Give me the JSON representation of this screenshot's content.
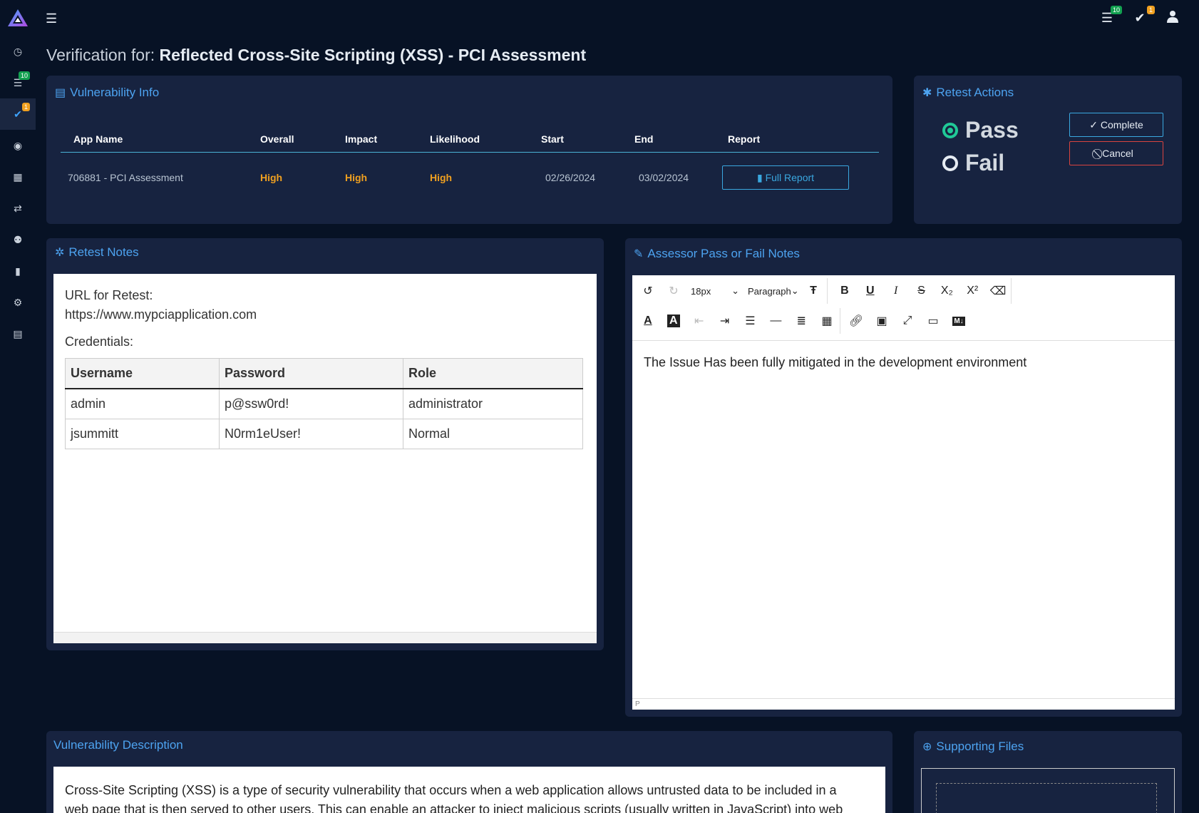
{
  "topbar": {
    "logo": "triangle-logo",
    "badges": {
      "list": "10",
      "check": "1"
    }
  },
  "sidebar": {
    "items": [
      {
        "icon": "dashboard-icon",
        "glyph": "◷"
      },
      {
        "icon": "list-icon",
        "glyph": "☰",
        "badge": "10"
      },
      {
        "icon": "check-icon",
        "glyph": "✔",
        "badge": "1",
        "active": true
      },
      {
        "icon": "eye-icon",
        "glyph": "◉"
      },
      {
        "icon": "calendar-icon",
        "glyph": "▦"
      },
      {
        "icon": "retweet-icon",
        "glyph": "⇄"
      },
      {
        "icon": "users-icon",
        "glyph": "⚉"
      },
      {
        "icon": "chart-icon",
        "glyph": "▮"
      },
      {
        "icon": "gear-icon",
        "glyph": "⚙"
      },
      {
        "icon": "book-icon",
        "glyph": "▤"
      }
    ]
  },
  "page": {
    "title_prefix": "Verification for:",
    "title_name": "Reflected Cross-Site Scripting (XSS) - PCI Assessment"
  },
  "vuln_info": {
    "title": "Vulnerability Info",
    "headers": [
      "App Name",
      "Overall",
      "Impact",
      "Likelihood",
      "Start",
      "End",
      "Report"
    ],
    "row": {
      "app_name": "706881 - PCI Assessment",
      "overall": "High",
      "impact": "High",
      "likelihood": "High",
      "start": "02/26/2024",
      "end": "03/02/2024",
      "report_button": "Full Report"
    }
  },
  "retest_actions": {
    "title": "Retest Actions",
    "pass_label": "Pass",
    "fail_label": "Fail",
    "complete_label": "Complete",
    "cancel_label": "Cancel"
  },
  "retest_notes": {
    "title": "Retest Notes",
    "url_label": "URL for Retest:",
    "url": "https://www.mypciapplication.com",
    "credentials_label": "Credentials:",
    "headers": [
      "Username",
      "Password",
      "Role"
    ],
    "rows": [
      [
        "admin",
        "p@ssw0rd!",
        "administrator"
      ],
      [
        "jsummitt",
        "N0rm1eUser!",
        "Normal"
      ]
    ]
  },
  "assessor_notes": {
    "title": "Assessor Pass or Fail Notes",
    "font_size": "18px",
    "block_format": "Paragraph",
    "content": "The Issue Has been fully mitigated in the development environment",
    "status_path": "P"
  },
  "description": {
    "title": "Vulnerability Description",
    "text": "Cross-Site Scripting (XSS) is a type of security vulnerability that occurs when a web application allows untrusted data to be included in a web page that is then served to other users. This can enable an attacker to inject malicious scripts (usually written in JavaScript) into web pages"
  },
  "supporting_files": {
    "title": "Supporting Files"
  }
}
